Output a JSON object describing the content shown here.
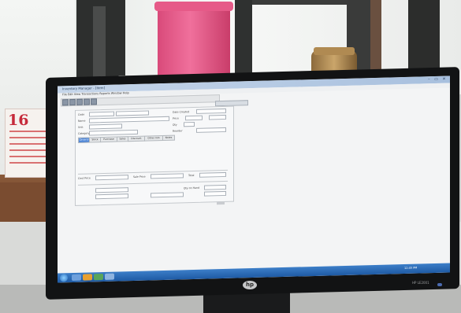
{
  "calendar": {
    "day_number": "16"
  },
  "monitor": {
    "brand_logo": "hp",
    "model_label": "HP LE2001"
  },
  "app": {
    "title": "Inventory Manager - [Item]",
    "menu": "File   Edit   View   Transactions   Reports   Window   Help",
    "window_controls": "– ▭ ✕",
    "labels": {
      "code": "Code",
      "name": "Name",
      "unit": "Unit",
      "category": "Category",
      "date_created": "Date Created",
      "price": "Price",
      "qty": "Qty",
      "reorder": "Reorder"
    },
    "tabs": [
      "General",
      "Stock",
      "Purchase",
      "Sales",
      "Discount",
      "Other Info",
      "Notes"
    ],
    "lower_labels": {
      "cost_price": "Cost Price",
      "sale_price": "Sale Price",
      "total": "Total",
      "qty_on_hand": "Qty on Hand"
    }
  },
  "taskbar": {
    "clock": "12:45 PM"
  },
  "colors": {
    "taskbar": "#1e5aa4",
    "titlebar": "#a8c0de",
    "active_tab": "#4a84d8",
    "pink_bottle": "#f0709c",
    "calendar_red": "#c62a3a"
  }
}
